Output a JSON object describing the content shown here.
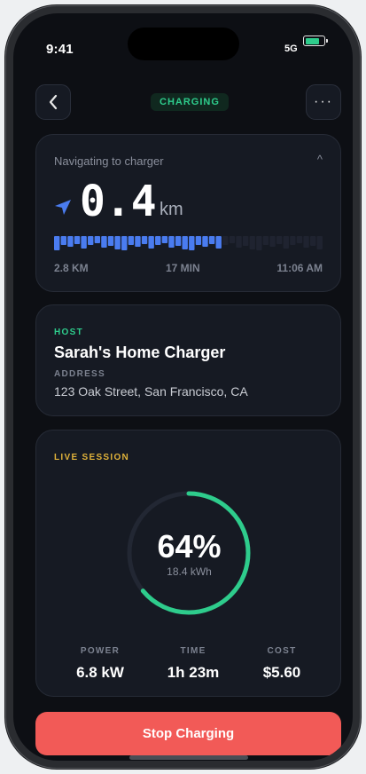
{
  "status_bar": {
    "time": "9:41",
    "network": "5G",
    "battery_level": 0.78
  },
  "header": {
    "status_pill": "CHARGING",
    "back_icon": "chevron-left-icon",
    "more_icon": "ellipsis-icon",
    "more_label": "···"
  },
  "navigation": {
    "title": "Navigating to charger",
    "collapse_glyph": "^",
    "distance": "0.4",
    "unit": "km",
    "remaining_distance": "2.8 KM",
    "eta_duration": "17 MIN",
    "arrival_time": "11:06 AM",
    "route_progress": 0.62
  },
  "host": {
    "label": "HOST",
    "name": "Sarah's Home Charger",
    "address_label": "ADDRESS",
    "address": "123 Oak Street, San Francisco, CA"
  },
  "session": {
    "label": "LIVE SESSION",
    "percent": "64%",
    "percent_value": 64,
    "energy": "18.4 kWh",
    "metrics": [
      {
        "label": "POWER",
        "value": "6.8 kW"
      },
      {
        "label": "TIME",
        "value": "1h 23m"
      },
      {
        "label": "COST",
        "value": "$5.60"
      }
    ]
  },
  "actions": {
    "stop_label": "Stop Charging"
  },
  "colors": {
    "accent_green": "#2ecc8c",
    "accent_blue": "#4a7cf0",
    "gold_label": "#e0b23a",
    "danger": "#f25a57"
  }
}
